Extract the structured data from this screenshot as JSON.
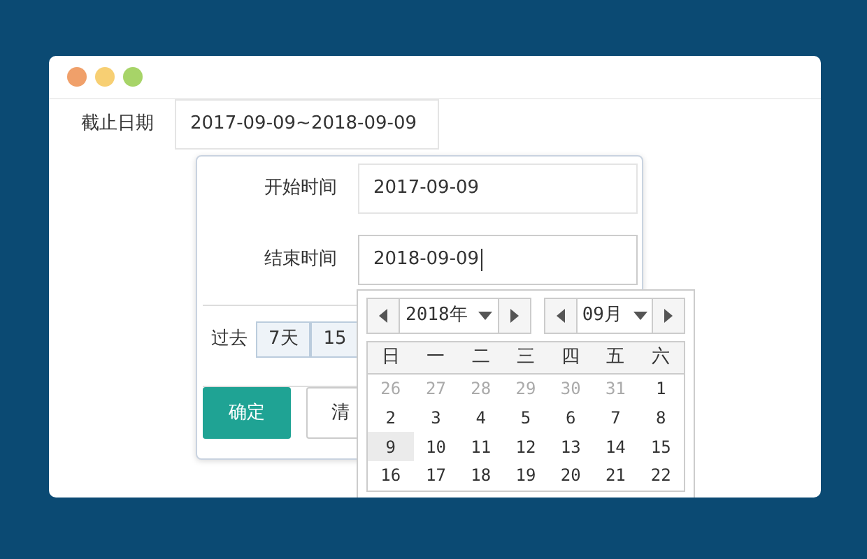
{
  "field": {
    "label": "截止日期",
    "value": "2017-09-09~2018-09-09"
  },
  "range_panel": {
    "start": {
      "label": "开始时间",
      "value": "2017-09-09"
    },
    "end": {
      "label": "结束时间",
      "value": "2018-09-09",
      "focused": true
    },
    "quick": {
      "label": "过去",
      "options": [
        "7天",
        "15"
      ]
    },
    "buttons": [
      {
        "label": "确定",
        "kind": "primary"
      },
      {
        "label": "清",
        "kind": "default"
      }
    ]
  },
  "calendar": {
    "year": "2018年",
    "month": "09月",
    "weekdays": [
      "日",
      "一",
      "二",
      "三",
      "四",
      "五",
      "六"
    ],
    "weeks": [
      [
        {
          "day": "26",
          "other_month": true,
          "selected": false
        },
        {
          "day": "27",
          "other_month": true,
          "selected": false
        },
        {
          "day": "28",
          "other_month": true,
          "selected": false
        },
        {
          "day": "29",
          "other_month": true,
          "selected": false
        },
        {
          "day": "30",
          "other_month": true,
          "selected": false
        },
        {
          "day": "31",
          "other_month": true,
          "selected": false
        },
        {
          "day": "1",
          "other_month": false,
          "selected": false
        }
      ],
      [
        {
          "day": "2",
          "other_month": false,
          "selected": false
        },
        {
          "day": "3",
          "other_month": false,
          "selected": false
        },
        {
          "day": "4",
          "other_month": false,
          "selected": false
        },
        {
          "day": "5",
          "other_month": false,
          "selected": false
        },
        {
          "day": "6",
          "other_month": false,
          "selected": false
        },
        {
          "day": "7",
          "other_month": false,
          "selected": false
        },
        {
          "day": "8",
          "other_month": false,
          "selected": false
        }
      ],
      [
        {
          "day": "9",
          "other_month": false,
          "selected": true
        },
        {
          "day": "10",
          "other_month": false,
          "selected": false
        },
        {
          "day": "11",
          "other_month": false,
          "selected": false
        },
        {
          "day": "12",
          "other_month": false,
          "selected": false
        },
        {
          "day": "13",
          "other_month": false,
          "selected": false
        },
        {
          "day": "14",
          "other_month": false,
          "selected": false
        },
        {
          "day": "15",
          "other_month": false,
          "selected": false
        }
      ],
      [
        {
          "day": "16",
          "other_month": false,
          "selected": false
        },
        {
          "day": "17",
          "other_month": false,
          "selected": false
        },
        {
          "day": "18",
          "other_month": false,
          "selected": false
        },
        {
          "day": "19",
          "other_month": false,
          "selected": false
        },
        {
          "day": "20",
          "other_month": false,
          "selected": false
        },
        {
          "day": "21",
          "other_month": false,
          "selected": false
        },
        {
          "day": "22",
          "other_month": false,
          "selected": false
        }
      ]
    ]
  }
}
